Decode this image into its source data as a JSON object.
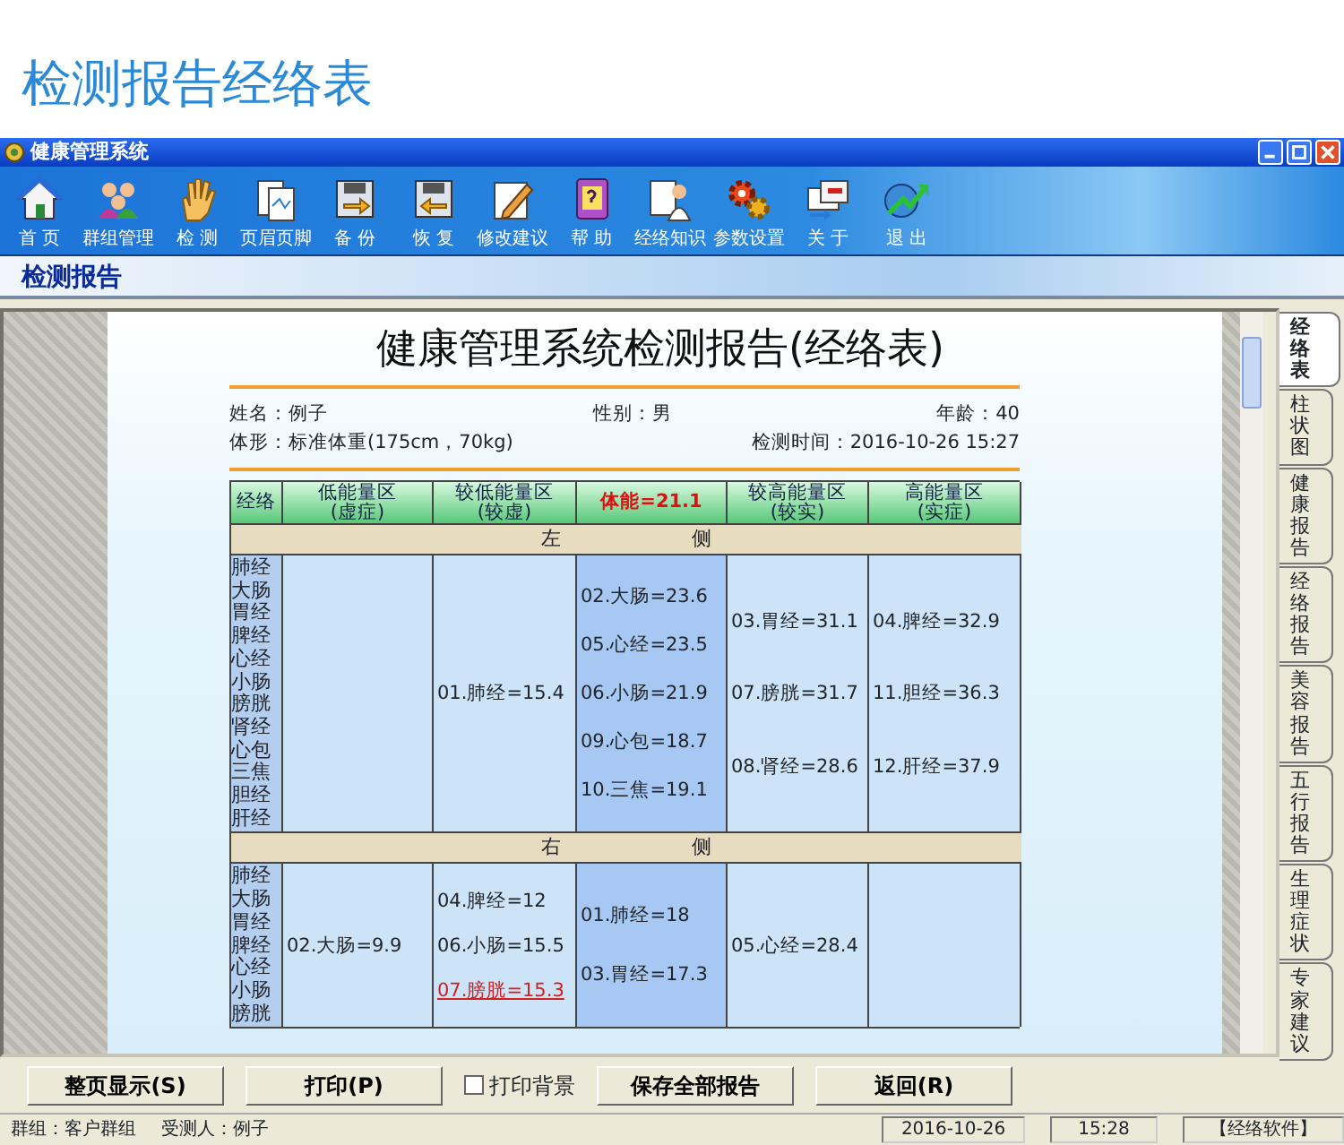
{
  "page_heading": "检测报告经络表",
  "window": {
    "title": "健康管理系统"
  },
  "toolbar": [
    {
      "label": "首 页"
    },
    {
      "label": "群组管理"
    },
    {
      "label": "检 测"
    },
    {
      "label": "页眉页脚"
    },
    {
      "label": "备 份"
    },
    {
      "label": "恢 复"
    },
    {
      "label": "修改建议"
    },
    {
      "label": "帮 助"
    },
    {
      "label": "经络知识"
    },
    {
      "label": "参数设置"
    },
    {
      "label": "关 于"
    },
    {
      "label": "退 出"
    }
  ],
  "section_title": "检测报告",
  "report": {
    "title": "健康管理系统检测报告(经络表)",
    "info_rows": [
      [
        "姓名：例子",
        "性别：男",
        "年龄：40"
      ],
      [
        "体形：标准体重(175cm，70kg)",
        "检测时间：2016-10-26 15:27"
      ]
    ],
    "columns": [
      {
        "text": "经络",
        "kind": "name"
      },
      {
        "text": "低能量区\n(虚症)",
        "kind": "zone"
      },
      {
        "text": "较低能量区\n(较虚)",
        "kind": "zone"
      },
      {
        "text": "体能=21.1",
        "kind": "body"
      },
      {
        "text": "较高能量区\n(较实)",
        "kind": "zone"
      },
      {
        "text": "高能量区\n(实症)",
        "kind": "zone"
      }
    ],
    "sections": [
      {
        "label": "左 侧",
        "meridians": [
          "肺经",
          "大肠",
          "胃经",
          "脾经",
          "心经",
          "小肠",
          "膀胱",
          "肾经",
          "心包",
          "三焦",
          "胆经",
          "肝经"
        ],
        "cells": [
          {},
          {
            "entries": [
              {
                "text": "01.肺经=15.4",
                "hovered": false
              }
            ]
          },
          {
            "entries": [
              {
                "text": "02.大肠=23.6",
                "hovered": false
              },
              {
                "text": "05.心经=23.5",
                "hovered": false
              },
              {
                "text": "06.小肠=21.9",
                "hovered": false
              },
              {
                "text": "09.心包=18.7",
                "hovered": false
              },
              {
                "text": "10.三焦=19.1",
                "hovered": false
              }
            ]
          },
          {
            "entries": [
              {
                "text": "03.胃经=31.1",
                "hovered": false
              },
              {
                "text": "07.膀胱=31.7",
                "hovered": false
              },
              {
                "text": "08.肾经=28.6",
                "hovered": false
              }
            ]
          },
          {
            "entries": [
              {
                "text": "04.脾经=32.9",
                "hovered": false
              },
              {
                "text": "11.胆经=36.3",
                "hovered": false
              },
              {
                "text": "12.肝经=37.9",
                "hovered": false
              }
            ]
          }
        ]
      },
      {
        "label": "右 侧",
        "meridians": [
          "肺经",
          "大肠",
          "胃经",
          "脾经",
          "心经",
          "小肠",
          "膀胱"
        ],
        "cells": [
          {
            "entries": [
              {
                "text": "02.大肠=9.9",
                "hovered": false
              }
            ]
          },
          {
            "entries": [
              {
                "text": "04.脾经=12",
                "hovered": false
              },
              {
                "text": "06.小肠=15.5",
                "hovered": false
              },
              {
                "text": "07.膀胱=15.3",
                "hovered": true
              }
            ]
          },
          {
            "entries": [
              {
                "text": "01.肺经=18",
                "hovered": false
              },
              {
                "text": "03.胃经=17.3",
                "hovered": false
              }
            ]
          },
          {
            "entries": [
              {
                "text": "05.心经=28.4",
                "hovered": false
              }
            ]
          },
          {}
        ]
      }
    ]
  },
  "tabs": [
    {
      "label": "经络表",
      "selected": true
    },
    {
      "label": "柱状图",
      "selected": false
    },
    {
      "label": "健康报告",
      "selected": false
    },
    {
      "label": "经络报告",
      "selected": false
    },
    {
      "label": "美容报告",
      "selected": false
    },
    {
      "label": "五行报告",
      "selected": false
    },
    {
      "label": "生理症状",
      "selected": false
    },
    {
      "label": "专家建议",
      "selected": false
    }
  ],
  "actions": [
    {
      "kind": "button",
      "label": "整页显示(S)"
    },
    {
      "kind": "button",
      "label": "打印(P)"
    },
    {
      "kind": "checkbox",
      "label": "打印背景",
      "checked": false
    },
    {
      "kind": "button",
      "label": "保存全部报告"
    },
    {
      "kind": "button",
      "label": "返回(R)"
    }
  ],
  "status_bar": {
    "left": [
      "群组：客户群组",
      "受测人：例子"
    ],
    "panels": [
      "2016-10-26",
      "15:28",
      "【经络软件】"
    ]
  }
}
